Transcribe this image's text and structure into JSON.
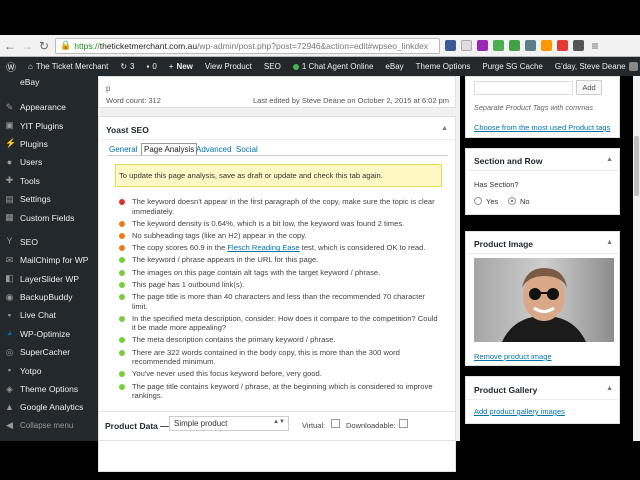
{
  "browser": {
    "url_scheme": "https://",
    "url_host": "theticketmerchant.com.au",
    "url_path": "/wp-admin/post.php?post=72946&action=edit#wpseo_linkdex"
  },
  "admin_bar": {
    "site_name": "The Ticket Merchant",
    "updates_count": "3",
    "comments_count": "0",
    "new_label": "New",
    "view_product": "View Product",
    "seo": "SEO",
    "chat_agents": "1 Chat Agent Online",
    "ebay": "eBay",
    "theme_options": "Theme Options",
    "purge_cache": "Purge SG Cache",
    "greeting": "G'day, Steve Deane"
  },
  "sidebar": {
    "items": [
      {
        "label": "eBay"
      },
      {
        "label": "Appearance"
      },
      {
        "label": "YIT Plugins"
      },
      {
        "label": "Plugins"
      },
      {
        "label": "Users"
      },
      {
        "label": "Tools"
      },
      {
        "label": "Settings"
      },
      {
        "label": "Custom Fields"
      },
      {
        "label": "SEO"
      },
      {
        "label": "MailChimp for WP"
      },
      {
        "label": "LayerSlider WP"
      },
      {
        "label": "BackupBuddy"
      },
      {
        "label": "Live Chat"
      },
      {
        "label": "WP-Optimize"
      },
      {
        "label": "SuperCacher"
      },
      {
        "label": "Yotpo"
      },
      {
        "label": "Theme Options"
      },
      {
        "label": "Google Analytics"
      },
      {
        "label": "Collapse menu"
      }
    ]
  },
  "editor": {
    "paragraph_tag": "p",
    "word_count": "Word count: 312",
    "last_edited": "Last edited by Steve Deane on October 2, 2015 at 6:02 pm"
  },
  "yoast": {
    "title": "Yoast SEO",
    "tabs": [
      "General",
      "Page Analysis",
      "Advanced",
      "Social"
    ],
    "notice": "To update this page analysis, save as draft or update and check this tab again.",
    "items": [
      {
        "color": "#dc3232",
        "text": "The keyword doesn't appear in the first paragraph of the copy, make sure the topic is clear immediately."
      },
      {
        "color": "#ee7c1b",
        "text": "The keyword density is 0.64%, which is a bit low, the keyword was found 2 times."
      },
      {
        "color": "#ee7c1b",
        "text": "No subheading tags (like an H2) appear in the copy."
      },
      {
        "color": "#ee7c1b",
        "text_before": "The copy scores 60.9 in the ",
        "link": "Flesch Reading Ease",
        "text_after": " test, which is considered OK to read."
      },
      {
        "color": "#7ad03a",
        "text": "The keyword / phrase appears in the URL for this page."
      },
      {
        "color": "#7ad03a",
        "text": "The images on this page contain alt tags with the target keyword / phrase."
      },
      {
        "color": "#7ad03a",
        "text": "This page has 1 outbound link(s)."
      },
      {
        "color": "#7ad03a",
        "text": "The page title is more than 40 characters and less than the recommended 70 character limit."
      },
      {
        "color": "#7ad03a",
        "text": "In the specified meta description, consider: How does it compare to the competition? Could it be made more appealing?"
      },
      {
        "color": "#7ad03a",
        "text": "The meta description contains the primary keyword / phrase."
      },
      {
        "color": "#7ad03a",
        "text": "There are 322 words contained in the body copy, this is more than the 300 word recommended minimum."
      },
      {
        "color": "#7ad03a",
        "text": "You've never used this focus keyword before, very good."
      },
      {
        "color": "#7ad03a",
        "text": "The page title contains keyword / phrase, at the beginning which is considered to improve rankings."
      }
    ]
  },
  "product_data": {
    "label": "Product Data —",
    "type_value": "Simple product",
    "virtual": "Virtual:",
    "downloadable": "Downloadable:"
  },
  "tags": {
    "add_button": "Add",
    "hint": "Separate Product Tags with commas",
    "choose_link": "Choose from the most used Product tags"
  },
  "section_row": {
    "title": "Section and Row",
    "question": "Has Section?",
    "yes": "Yes",
    "no": "No"
  },
  "product_image": {
    "title": "Product Image",
    "remove_link": "Remove product image"
  },
  "gallery": {
    "title": "Product Gallery",
    "add_link": "Add product gallery images"
  }
}
